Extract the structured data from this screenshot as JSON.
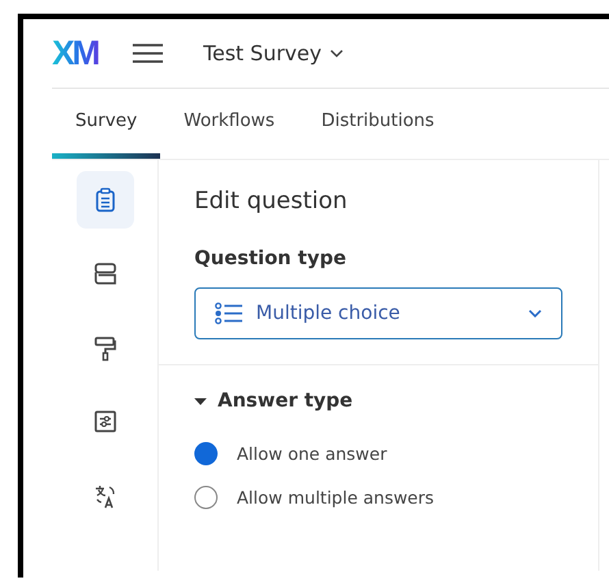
{
  "header": {
    "logo": "XM",
    "survey_name": "Test Survey"
  },
  "tabs": [
    {
      "label": "Survey",
      "selected": true
    },
    {
      "label": "Workflows",
      "selected": false
    },
    {
      "label": "Distributions",
      "selected": false
    }
  ],
  "sidebar": {
    "items": [
      {
        "kind": "clipboard",
        "selected": true
      },
      {
        "kind": "blocks",
        "selected": false
      },
      {
        "kind": "roller",
        "selected": false
      },
      {
        "kind": "options",
        "selected": false
      },
      {
        "kind": "translate",
        "selected": false
      }
    ]
  },
  "panel": {
    "title": "Edit question",
    "question_type_label": "Question type",
    "question_type": "Multiple choice",
    "answer_section": {
      "title": "Answer type",
      "expanded": true,
      "options": [
        {
          "label": "Allow one answer",
          "selected": true
        },
        {
          "label": "Allow multiple answers",
          "selected": false
        }
      ]
    }
  }
}
